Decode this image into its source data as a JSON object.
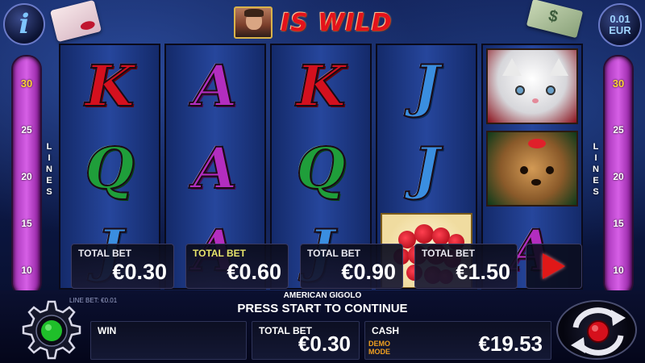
{
  "header": {
    "info_glyph": "i",
    "wild_text": "IS WILD",
    "denomination": {
      "value": "0.01",
      "currency": "EUR"
    }
  },
  "lines": {
    "label": "LINES",
    "values": [
      "30",
      "25",
      "20",
      "15",
      "10"
    ],
    "selected": "30"
  },
  "reels": [
    {
      "cells": [
        {
          "symbol": "K",
          "color": "red"
        },
        {
          "symbol": "Q",
          "color": "green"
        },
        {
          "symbol": "J",
          "color": "blue"
        }
      ]
    },
    {
      "cells": [
        {
          "symbol": "A",
          "color": "purple"
        },
        {
          "symbol": "A",
          "color": "purple"
        },
        {
          "symbol": "A",
          "color": "purple"
        }
      ]
    },
    {
      "cells": [
        {
          "symbol": "K",
          "color": "red"
        },
        {
          "symbol": "Q",
          "color": "green"
        },
        {
          "symbol": "J",
          "color": "blue"
        }
      ]
    },
    {
      "cells": [
        {
          "symbol": "J",
          "color": "blue"
        },
        {
          "symbol": "J",
          "color": "blue"
        },
        {
          "symbol": "hearts-icon",
          "color": "image"
        }
      ]
    },
    {
      "cells": [
        {
          "symbol": "cat-icon",
          "color": "image"
        },
        {
          "symbol": "dog-icon",
          "color": "image"
        },
        {
          "symbol": "A",
          "color": "purple"
        }
      ]
    }
  ],
  "bet_options": [
    {
      "label": "TOTAL BET",
      "value": "€0.30",
      "selected": false
    },
    {
      "label": "TOTAL BET",
      "value": "€0.60",
      "selected": true
    },
    {
      "label": "TOTAL BET",
      "value": "€0.90",
      "selected": false
    },
    {
      "label": "TOTAL BET",
      "value": "€1.50",
      "selected": false
    }
  ],
  "footer": {
    "game_name": "AMERICAN GIGOLO",
    "prompt": "PRESS START TO CONTINUE",
    "line_bet": "LINE BET: €0.01",
    "win": {
      "label": "WIN",
      "value": ""
    },
    "total_bet": {
      "label": "TOTAL BET",
      "value": "€0.30"
    },
    "cash": {
      "label": "CASH",
      "value": "€19.53",
      "mode_line1": "DEMO",
      "mode_line2": "MODE"
    }
  },
  "colors": {
    "red_symbol": "#d4101e",
    "purple_symbol": "#b32dbf",
    "green_symbol": "#1f9e3a",
    "blue_symbol": "#3a8ee0",
    "selected_label": "#e7e36a",
    "start_button": "#e01818",
    "settings_light": "#1fbf2a"
  }
}
